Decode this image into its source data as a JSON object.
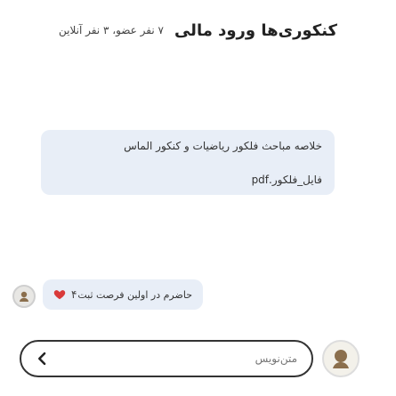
{
  "header": {
    "title": "کنکوری‌ها ورود مالی",
    "meta": "۷ نفر عضو، ۳ نفر آنلاین",
    "colors": {
      "title": "#222222",
      "meta": "#444444"
    }
  },
  "chat": {
    "messages": [
      {
        "text": "خلاصه مباحث فلکور ریاضیات و کنکور الماس",
        "file": "فایل_فلکور.pdf"
      },
      {
        "text": "حاضرم در اولین فرصت ثبت",
        "likes": "۴",
        "icons": {
          "like": "heart-icon"
        }
      }
    ],
    "colors": {
      "bubble_bg": "#e8eef7"
    }
  },
  "composer": {
    "placeholder": "متن‌نویس",
    "send_icon": "send-arrow-icon"
  },
  "avatars": {
    "user_avatar_icon": "user-avatar-icon",
    "bot_avatar_icon": "bot-avatar-icon"
  }
}
